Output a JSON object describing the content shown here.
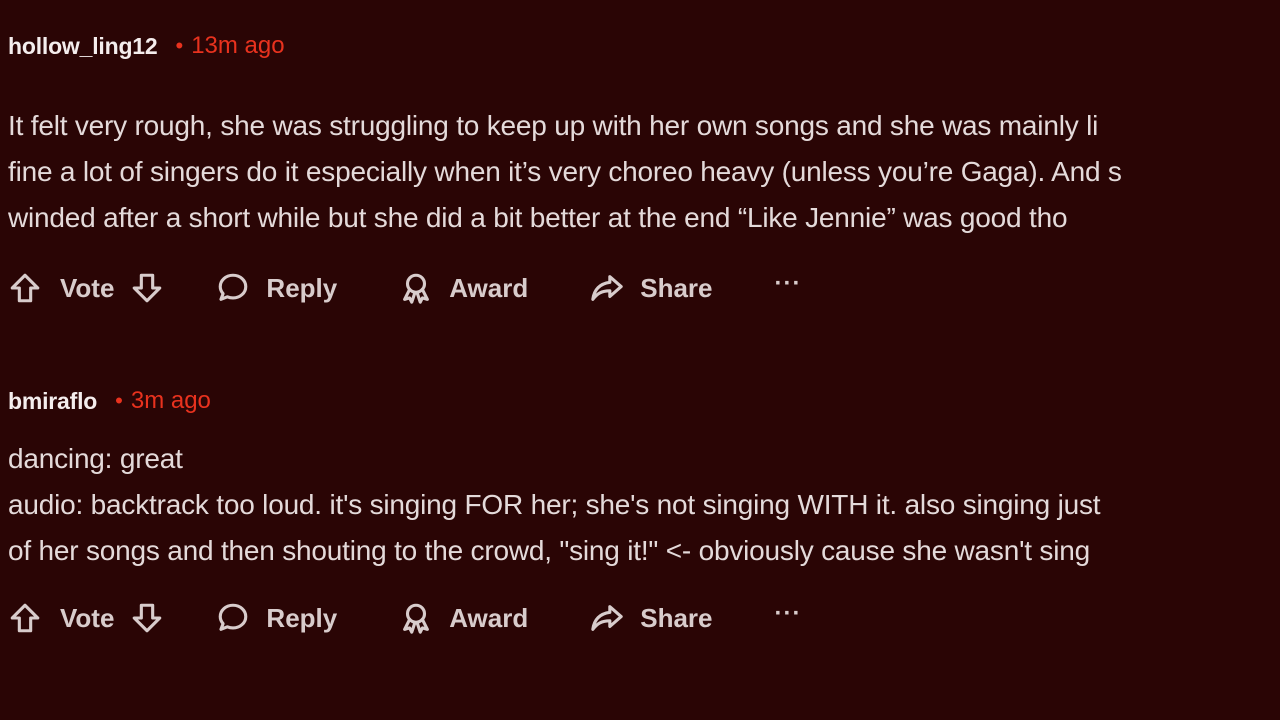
{
  "comments": [
    {
      "username": "hollow_ling12",
      "separator": "•",
      "time": "13m ago",
      "lines": [
        "It felt very rough, she was struggling to keep up with her own songs and she was mainly li",
        "fine a lot of singers do it especially when it’s very choreo heavy (unless you’re Gaga). And s",
        "winded after a short while but she did a bit better at the end “Like Jennie” was good tho"
      ],
      "actions": {
        "vote": "Vote",
        "reply": "Reply",
        "award": "Award",
        "share": "Share",
        "more": "···"
      }
    },
    {
      "username": "bmiraflo",
      "separator": "•",
      "time": "3m ago",
      "lines": [
        "dancing: great",
        "audio: backtrack too loud. it's singing FOR her; she's not singing WITH it. also singing just",
        "of her songs and then shouting to the crowd, \"sing it!\" <- obviously cause she wasn't sing"
      ],
      "actions": {
        "vote": "Vote",
        "reply": "Reply",
        "award": "Award",
        "share": "Share",
        "more": "···"
      }
    }
  ],
  "icons": {
    "upvote": "arrow-up-icon",
    "downvote": "arrow-down-icon",
    "reply": "speech-bubble-icon",
    "award": "award-ribbon-icon",
    "share": "share-arrow-icon"
  },
  "colors": {
    "background": "#2a0505",
    "accent_time": "#e8321e",
    "text": "#e4dada"
  }
}
